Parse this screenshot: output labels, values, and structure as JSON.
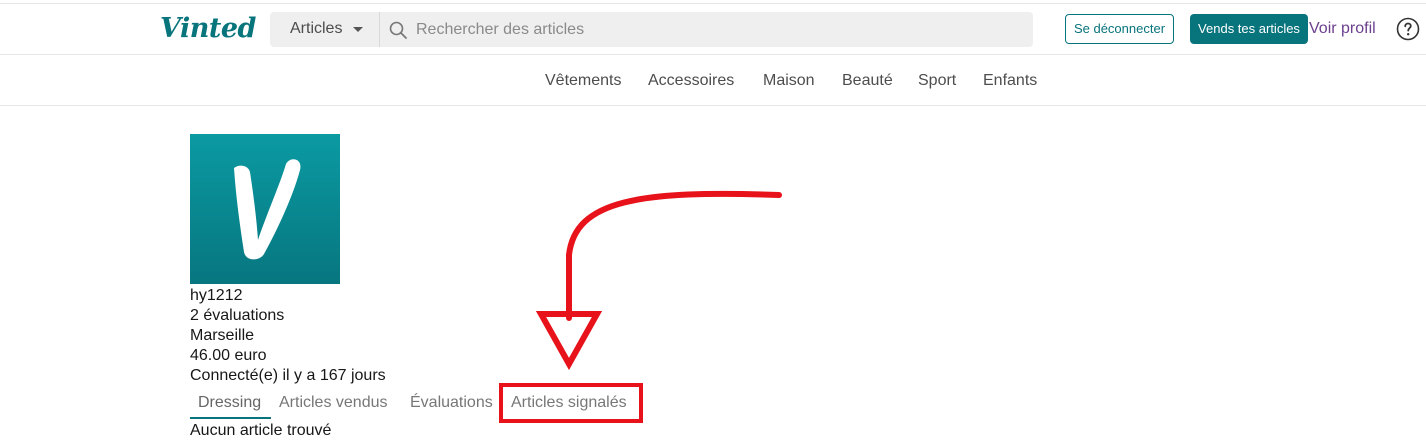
{
  "header": {
    "logo": "Vinted",
    "category_select": "Articles",
    "search_placeholder": "Rechercher des articles",
    "logout_label": "Se déconnecter",
    "sell_label": "Vends tes articles",
    "profile_label": "Voir profil",
    "help_icon": "question-circle-icon"
  },
  "categories": [
    "Vêtements",
    "Accessoires",
    "Maison",
    "Beauté",
    "Sport",
    "Enfants"
  ],
  "profile": {
    "username": "hy1212",
    "ratings": "2 évaluations",
    "city": "Marseille",
    "balance": "46.00 euro",
    "last_seen": "Connecté(e) il y a 167 jours"
  },
  "tabs": [
    "Dressing",
    "Articles vendus",
    "Évaluations",
    "Articles signalés"
  ],
  "active_tab": "Dressing",
  "empty_message": "Aucun article trouvé",
  "colors": {
    "brand": "#08747c",
    "annotation": "#e8121b",
    "profile_link": "#6c3f8f"
  }
}
